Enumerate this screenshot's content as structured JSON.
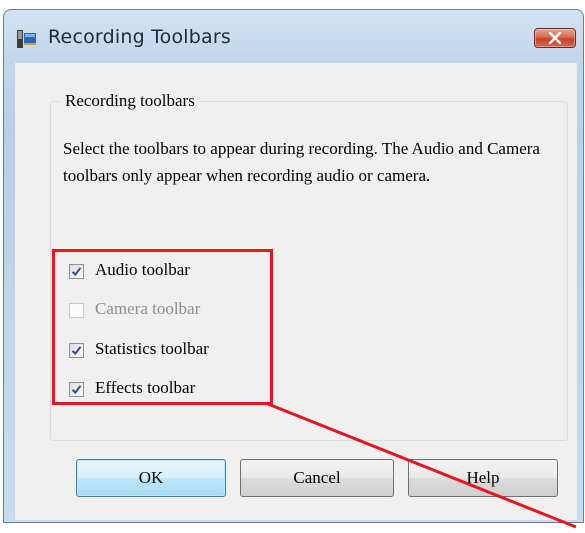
{
  "window": {
    "title": "Recording Toolbars"
  },
  "group": {
    "label": "Recording toolbars"
  },
  "description": "Select the toolbars to appear during recording. The Audio and Camera toolbars only appear when recording audio or camera.",
  "checkboxes": [
    {
      "label": "Audio toolbar",
      "checked": true,
      "enabled": true
    },
    {
      "label": "Camera toolbar",
      "checked": false,
      "enabled": false
    },
    {
      "label": "Statistics toolbar",
      "checked": true,
      "enabled": true
    },
    {
      "label": "Effects toolbar",
      "checked": true,
      "enabled": true
    }
  ],
  "buttons": {
    "ok": "OK",
    "cancel": "Cancel",
    "help": "Help"
  },
  "colors": {
    "annotation": "#e8161e",
    "titlebar": "#c3d7ec",
    "client": "#f0f0f0"
  },
  "icons": {
    "app": "recording-tool-icon",
    "close": "close-icon",
    "check": "checkmark-icon"
  }
}
